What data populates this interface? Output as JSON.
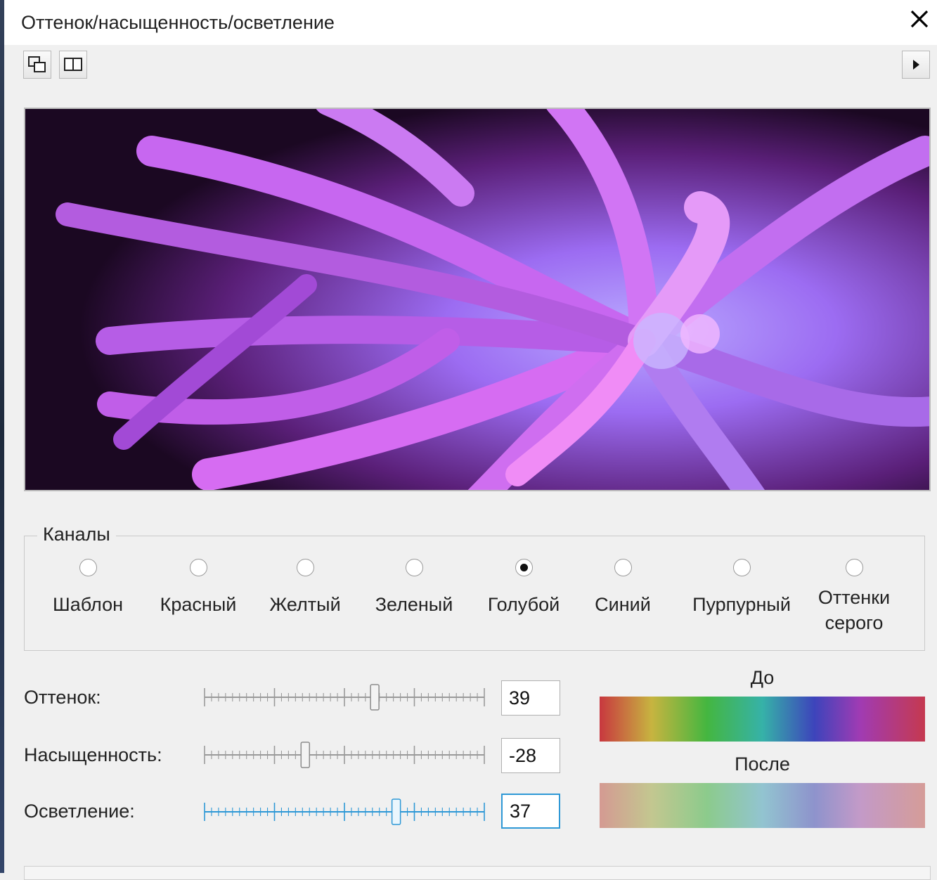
{
  "window": {
    "title": "Оттенок/насыщенность/осветление"
  },
  "toolbar": {
    "icons": [
      "preview-split-icon",
      "side-by-side-icon"
    ],
    "expand_icon": "play-triangle-icon"
  },
  "preview": {
    "description": ""
  },
  "channels": {
    "legend": "Каналы",
    "options": [
      {
        "label": "Шаблон",
        "selected": false
      },
      {
        "label": "Красный",
        "selected": false
      },
      {
        "label": "Желтый",
        "selected": false
      },
      {
        "label": "Зеленый",
        "selected": false
      },
      {
        "label": "Голубой",
        "selected": true
      },
      {
        "label": "Синий",
        "selected": false
      },
      {
        "label": "Пурпурный",
        "selected": false
      },
      {
        "label": "Оттенки серого",
        "line1": "Оттенки",
        "line2": "серого",
        "selected": false
      }
    ]
  },
  "adjustments": {
    "hue": {
      "label": "Оттенок:",
      "value": "39",
      "min": -180,
      "max": 180,
      "num": 39
    },
    "saturation": {
      "label": "Насыщенность:",
      "value": "-28",
      "min": -100,
      "max": 100,
      "num": -28
    },
    "lightness": {
      "label": "Осветление:",
      "value": "37",
      "min": -100,
      "max": 100,
      "num": 37,
      "focused": true
    }
  },
  "swatches": {
    "before_label": "До",
    "after_label": "После",
    "colors": {
      "focus": "#2e98d6"
    }
  }
}
